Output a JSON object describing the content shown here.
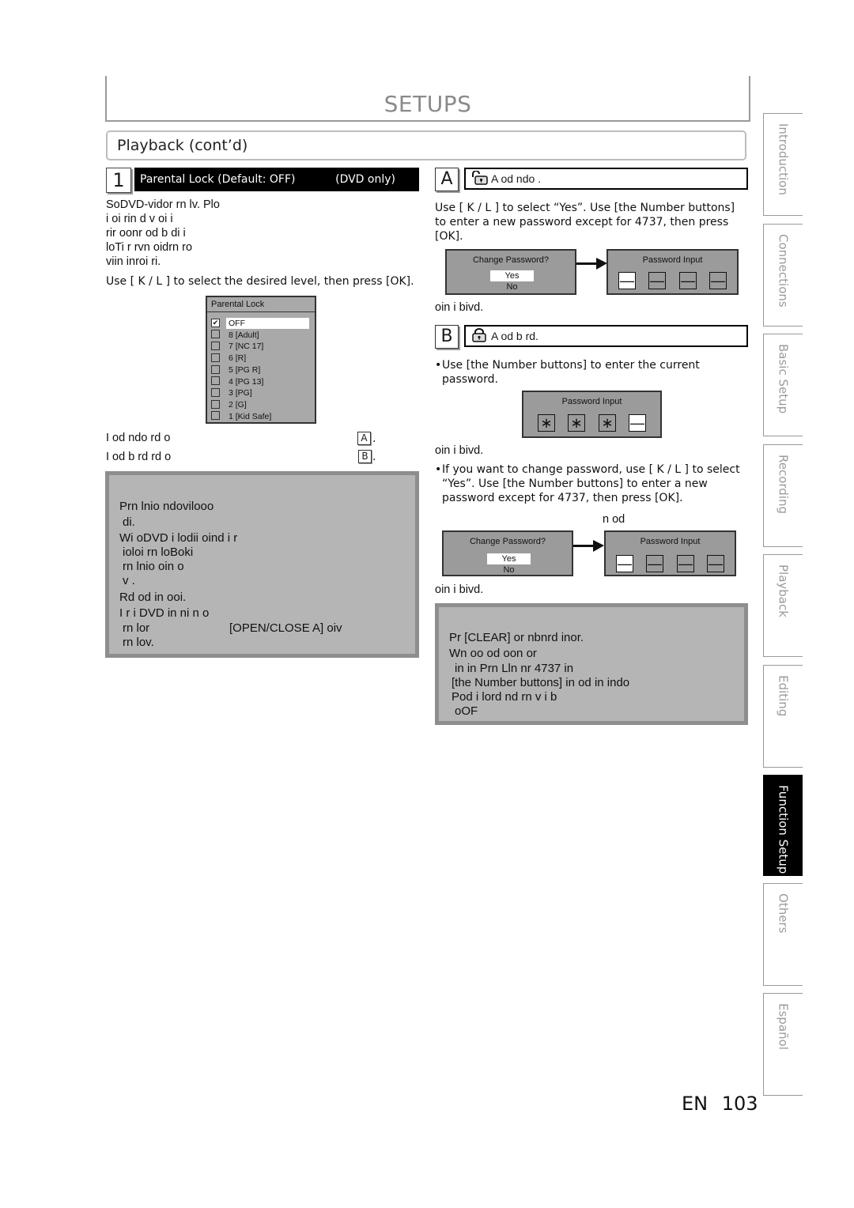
{
  "header": {
    "title": "SETUPS",
    "section": "Playback (cont’d)"
  },
  "step1": {
    "number": "1",
    "title": "Parental Lock (Default: OFF)",
    "scope": "(DVD only)",
    "paragraph": [
      "SoDVD-vidor rn lv. Plo",
      "i oi rin d v oi i",
      "rir oonr od b di i",
      "loTi r rvn oidrn ro",
      "viin inroi ri."
    ],
    "instruction": "Use [ K / L ] to select the desired level, then press [OK].",
    "menu": {
      "title": "Parental Lock",
      "items": [
        {
          "label": "OFF",
          "checked": true,
          "selected": true
        },
        {
          "label": "8 [Adult]",
          "checked": false,
          "selected": false
        },
        {
          "label": "7 [NC 17]",
          "checked": false,
          "selected": false
        },
        {
          "label": "6 [R]",
          "checked": false,
          "selected": false
        },
        {
          "label": "5 [PG R]",
          "checked": false,
          "selected": false
        },
        {
          "label": "4 [PG 13]",
          "checked": false,
          "selected": false
        },
        {
          "label": "3 [PG]",
          "checked": false,
          "selected": false
        },
        {
          "label": "2 [G]",
          "checked": false,
          "selected": false
        },
        {
          "label": "1 [Kid Safe]",
          "checked": false,
          "selected": false
        }
      ]
    },
    "ref_a_text": "I od ndo rd o",
    "ref_a_tag": "A",
    "ref_b_text": "I od b rd rd o",
    "ref_b_tag": "B",
    "note": {
      "lines": [
        "Prn lnio ndovilooo",
        "di.",
        "Wi oDVD i lodii oind i r",
        "ioloi rn loBoki",
        "rn lnio oin o",
        "v .",
        "Rd od in ooi.",
        "I r i DVD in ni n o",
        "rn lor",
        "[OPEN/CLOSE A] oiv",
        "rn lov."
      ]
    }
  },
  "sectionA": {
    "tag": "A",
    "title": "A od ndo .",
    "instruction": "Use [ K / L ] to select “Yes”. Use [the Number buttons] to enter a new password except for 4737, then press [OK].",
    "dialog_change": {
      "title": "Change Password?",
      "yes": "Yes",
      "no": "No"
    },
    "dialog_input": {
      "title": "Password Input",
      "cells": [
        "—",
        "—",
        "—",
        "—"
      ]
    },
    "result": "oin i bivd."
  },
  "sectionB": {
    "tag": "B",
    "title": "A od b rd.",
    "bullet1": "Use [the Number buttons] to enter the current password.",
    "dialog_input": {
      "title": "Password Input",
      "cells": [
        "∗",
        "∗",
        "∗",
        "—"
      ]
    },
    "result1": "oin i bivd.",
    "bullet2": "If you want to change password, use [ K / L ] to select “Yes”. Use [the Number buttons] to enter a new password except for 4737, then press [OK].",
    "caption": "n od",
    "dialog_change": {
      "title": "Change Password?",
      "yes": "Yes",
      "no": "No"
    },
    "dialog_input2": {
      "title": "Password Input",
      "cells": [
        "—",
        "—",
        "—",
        "—"
      ]
    },
    "result2": "oin i bivd.",
    "note": {
      "lines": [
        "Pr [CLEAR] or nbnrd inor.",
        "Wn oo od oon or",
        "in in Prn Lln nr 4737 in",
        "[the Number buttons] in od in indo",
        "Pod i lord nd rn v i b",
        "oOF"
      ]
    }
  },
  "side_tabs": [
    {
      "label": "Introduction",
      "active": false
    },
    {
      "label": "Connections",
      "active": false
    },
    {
      "label": "Basic Setup",
      "active": false
    },
    {
      "label": "Recording",
      "active": false
    },
    {
      "label": "Playback",
      "active": false
    },
    {
      "label": "Editing",
      "active": false
    },
    {
      "label": "Function Setup",
      "active": true
    },
    {
      "label": "Others",
      "active": false
    },
    {
      "label": "Español",
      "active": false
    }
  ],
  "footer": {
    "lang": "EN",
    "page": "103"
  }
}
